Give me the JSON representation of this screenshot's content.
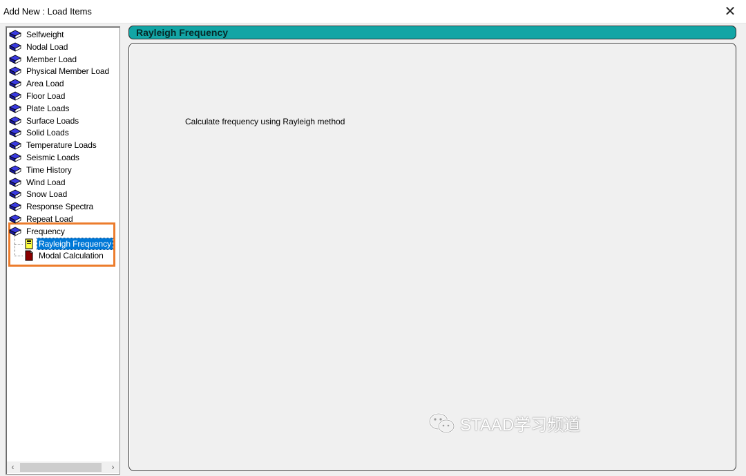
{
  "window": {
    "title": "Add New : Load Items",
    "close_label": "✕"
  },
  "tree": {
    "items": [
      {
        "label": "Selfweight"
      },
      {
        "label": "Nodal Load"
      },
      {
        "label": "Member Load"
      },
      {
        "label": "Physical Member Load"
      },
      {
        "label": "Area Load"
      },
      {
        "label": "Floor Load"
      },
      {
        "label": "Plate Loads"
      },
      {
        "label": "Surface Loads"
      },
      {
        "label": "Solid Loads"
      },
      {
        "label": "Temperature Loads"
      },
      {
        "label": "Seismic Loads"
      },
      {
        "label": "Time History"
      },
      {
        "label": "Wind Load"
      },
      {
        "label": "Snow Load"
      },
      {
        "label": "Response Spectra"
      },
      {
        "label": "Repeat Load"
      },
      {
        "label": "Frequency"
      }
    ],
    "children": [
      {
        "label": "Rayleigh Frequency",
        "selected": true,
        "icon": "frequency-doc-icon"
      },
      {
        "label": "Modal Calculation",
        "selected": false,
        "icon": "red-document-icon"
      }
    ],
    "scroll_left": "‹",
    "scroll_right": "›"
  },
  "panel": {
    "header": "Rayleigh Frequency",
    "description": "Calculate frequency using Rayleigh method"
  },
  "watermark": {
    "text": "STAAD学习频道"
  },
  "colors": {
    "header_bg": "#12a5a5",
    "selection": "#0078d7",
    "highlight": "#ec7c2c",
    "book_icon": "#2a2ad0"
  }
}
